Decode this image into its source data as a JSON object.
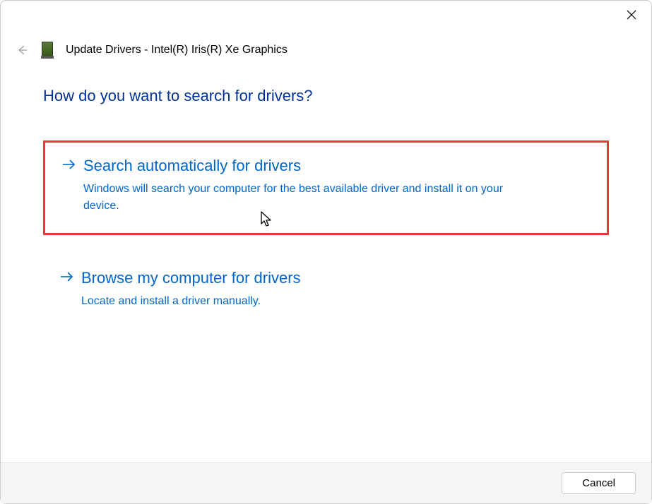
{
  "dialog": {
    "title": "Update Drivers - Intel(R) Iris(R) Xe Graphics",
    "question": "How do you want to search for drivers?"
  },
  "options": [
    {
      "title": "Search automatically for drivers",
      "description": "Windows will search your computer for the best available driver and install it on your device."
    },
    {
      "title": "Browse my computer for drivers",
      "description": "Locate and install a driver manually."
    }
  ],
  "buttons": {
    "cancel": "Cancel"
  }
}
